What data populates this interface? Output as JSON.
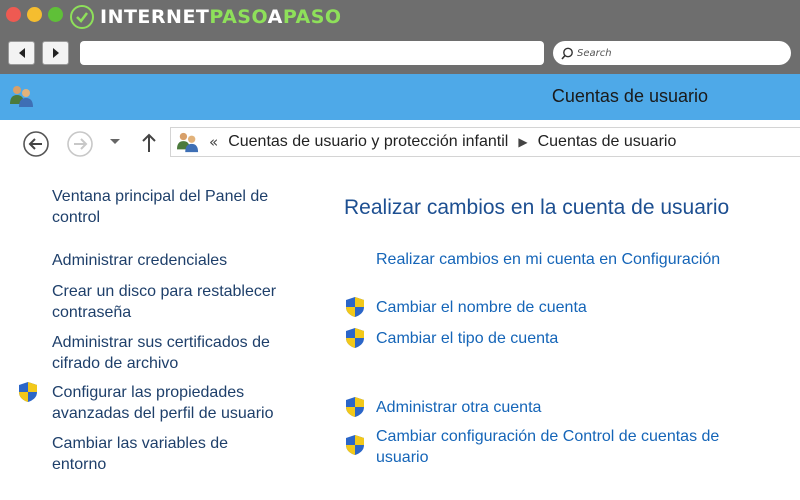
{
  "browser": {
    "logo": {
      "part1": "INTERNET",
      "part2": "PASO",
      "part3": "A",
      "part4": "PASO"
    },
    "search_placeholder": "Search",
    "back_icon": "back-arrow-icon",
    "forward_icon": "forward-arrow-icon"
  },
  "window": {
    "title": "Cuentas de usuario",
    "app_icon": "users-icon"
  },
  "address": {
    "breadcrumbs": [
      "Cuentas de usuario y protección infantil",
      "Cuentas de usuario"
    ],
    "prefix": "«"
  },
  "sidebar": {
    "items": [
      {
        "label": "Ventana principal del Panel de control",
        "shield": false
      },
      {
        "label": "Administrar credenciales",
        "shield": false
      },
      {
        "label": "Crear un disco para restablecer contraseña",
        "shield": false
      },
      {
        "label": "Administrar sus certificados de cifrado de archivo",
        "shield": false
      },
      {
        "label": "Configurar las propiedades avanzadas del perfil de usuario",
        "shield": true
      },
      {
        "label": "Cambiar las variables de entorno",
        "shield": false
      }
    ]
  },
  "main": {
    "heading": "Realizar cambios en la cuenta de usuario",
    "links": [
      {
        "label": "Realizar cambios en mi cuenta en Configuración",
        "shield": false
      },
      {
        "label": "Cambiar el nombre de cuenta",
        "shield": true
      },
      {
        "label": "Cambiar el tipo de cuenta",
        "shield": true
      },
      {
        "label": "Administrar otra cuenta",
        "shield": true
      },
      {
        "label": "Cambiar configuración de Control de cuentas de usuario",
        "shield": true
      }
    ]
  },
  "colors": {
    "titlebar": "#4ea9e8",
    "link": "#1565b8",
    "heading": "#1d4f91",
    "sidebar_link": "#1e3f6a"
  }
}
